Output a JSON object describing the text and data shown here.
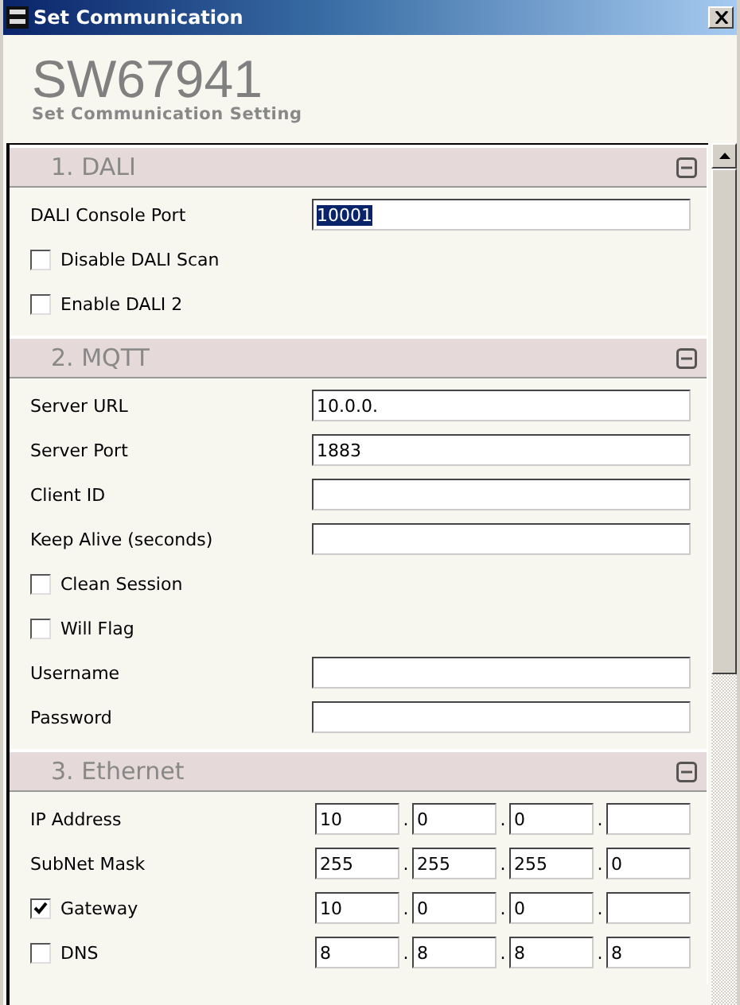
{
  "window": {
    "title": "Set Communication"
  },
  "header": {
    "title": "SW67941",
    "subtitle": "Set Communication Setting"
  },
  "sections": [
    {
      "title": "1. DALI",
      "expanded": true,
      "rows": [
        {
          "kind": "text",
          "label": "DALI Console Port",
          "value": "10001",
          "text_selected": true
        },
        {
          "kind": "checkbox",
          "label": "Disable DALI Scan",
          "checked": false
        },
        {
          "kind": "checkbox",
          "label": "Enable DALI 2",
          "checked": false
        }
      ]
    },
    {
      "title": "2. MQTT",
      "expanded": true,
      "rows": [
        {
          "kind": "text",
          "label": "Server URL",
          "value": "10.0.0.",
          "text_selected": false
        },
        {
          "kind": "text",
          "label": "Server Port",
          "value": "1883",
          "text_selected": false
        },
        {
          "kind": "text",
          "label": "Client ID",
          "text_selected": false
        },
        {
          "kind": "text",
          "label": "Keep Alive (seconds)",
          "text_selected": false
        },
        {
          "kind": "checkbox",
          "label": "Clean Session",
          "checked": false
        },
        {
          "kind": "checkbox",
          "label": "Will Flag",
          "checked": false
        },
        {
          "kind": "text",
          "label": "Username",
          "text_selected": false
        },
        {
          "kind": "text",
          "label": "Password",
          "text_selected": false
        }
      ]
    },
    {
      "title": "3. Ethernet",
      "expanded": true,
      "rows": [
        {
          "kind": "ip",
          "label": "IP Address",
          "separators": [
            ".",
            ".",
            "."
          ],
          "octets": [
            "10",
            "0",
            "0"
          ]
        },
        {
          "kind": "ip",
          "label": "SubNet Mask",
          "separators": [
            ".",
            ".",
            "."
          ],
          "octets": [
            "255",
            "255",
            "255",
            "0"
          ]
        },
        {
          "kind": "ip-check",
          "label": "Gateway",
          "checked": true,
          "separators": [
            ".",
            ".",
            "."
          ],
          "octets": [
            "10",
            "0",
            "0"
          ]
        },
        {
          "kind": "ip-check",
          "label": "DNS",
          "checked": false,
          "separators": [
            ".",
            ".",
            "."
          ],
          "octets": [
            "8",
            "8",
            "8",
            "8"
          ]
        }
      ]
    }
  ]
}
